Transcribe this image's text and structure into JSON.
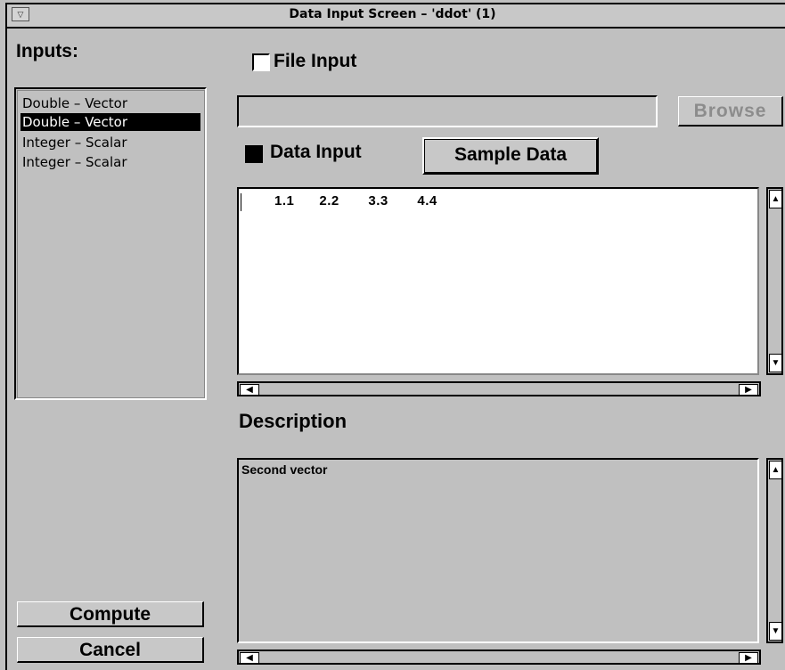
{
  "window": {
    "title": "Data Input Screen – 'ddot' (1)",
    "menu_glyph": "▽"
  },
  "inputs": {
    "label": "Inputs:",
    "items": [
      {
        "label": "Double – Vector",
        "selected": false
      },
      {
        "label": "Double – Vector",
        "selected": true
      },
      {
        "label": "Integer – Scalar",
        "selected": false
      },
      {
        "label": "Integer – Scalar",
        "selected": false
      }
    ]
  },
  "file_input": {
    "checkbox_label": "File Input",
    "checked": false,
    "path_value": "",
    "browse_label": "Browse",
    "browse_enabled": false
  },
  "data_input": {
    "checkbox_label": "Data Input",
    "checked": true,
    "sample_button_label": "Sample Data",
    "values_text": "1.1      2.2       3.3       4.4"
  },
  "description": {
    "label": "Description",
    "text": "Second vector"
  },
  "actions": {
    "compute_label": "Compute",
    "cancel_label": "Cancel"
  },
  "scroll": {
    "up_glyph": "▲",
    "down_glyph": "▼",
    "left_glyph": "◀",
    "right_glyph": "▶"
  },
  "colors": {
    "window_bg": "#c0c0c0",
    "selection_bg": "#000000",
    "selection_fg": "#ffffff",
    "disabled_text": "#8c8c8c"
  }
}
